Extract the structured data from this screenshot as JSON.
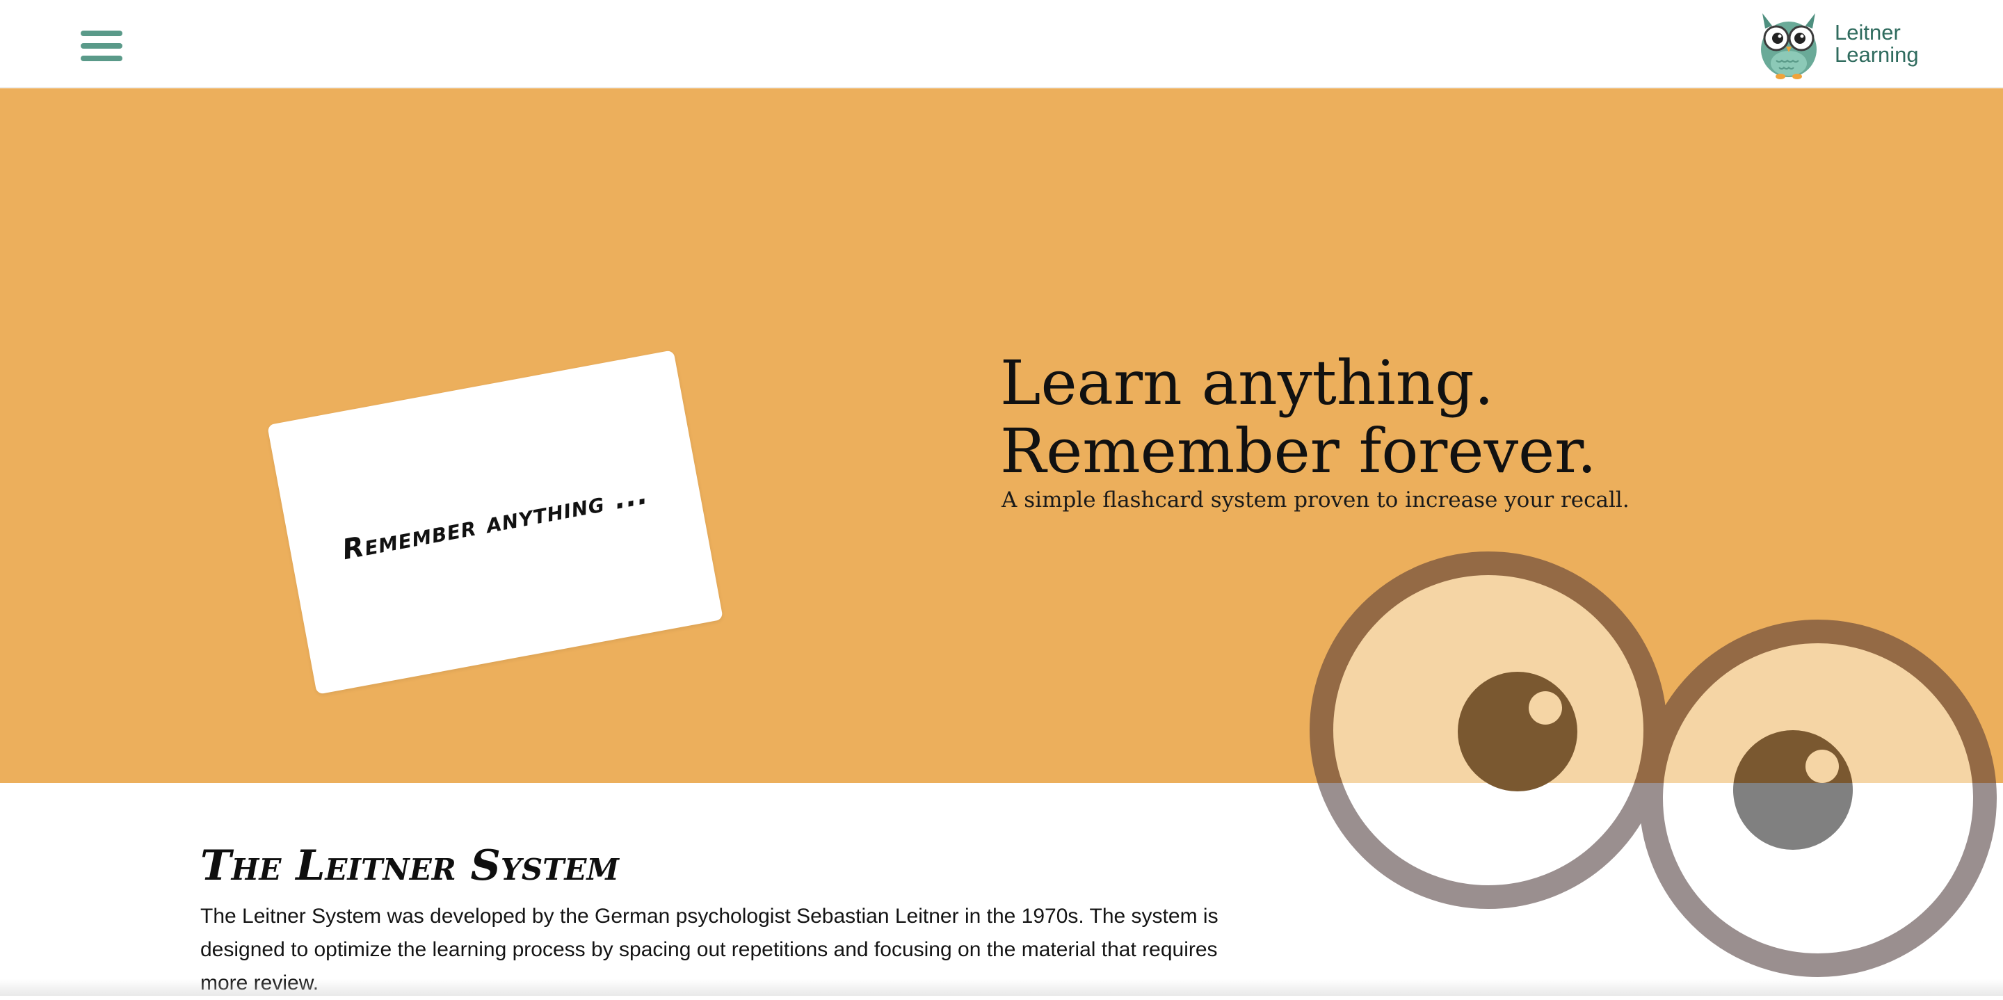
{
  "header": {
    "menu_icon": "hamburger-menu-icon",
    "brand": {
      "logo_icon": "owl-logo-icon",
      "name": "Leitner Learning"
    }
  },
  "hero": {
    "flashcard_text": "Remember anything ...",
    "heading_line1": "Learn anything.",
    "heading_line2": "Remember forever.",
    "subtitle": "A simple flashcard system proven to increase your recall.",
    "decoration_icon": "owl-eyes-icon"
  },
  "section": {
    "title": "The Leitner System",
    "body": "The Leitner System was developed by the German psychologist Sebastian Leitner in the 1970s. The system is designed to optimize the learning process by spacing out repetitions and focusing on the material that requires more review."
  },
  "colors": {
    "hero_background": "#ecaf5c",
    "brand_green": "#5a9a89",
    "brand_text": "#2f6b5e",
    "eye_ring": "#8a6744",
    "pupil": "#7a5830"
  }
}
